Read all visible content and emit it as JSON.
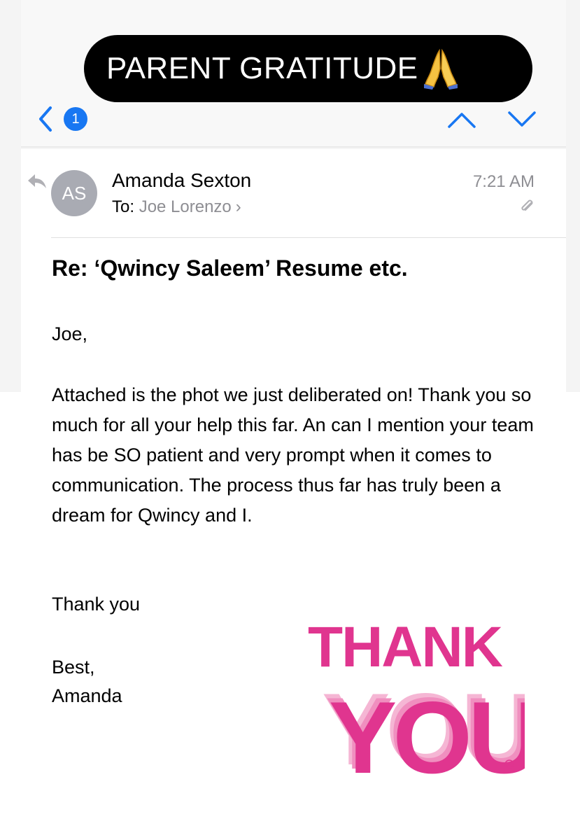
{
  "caption": {
    "text": "PARENT GRATITUDE",
    "emoji": "folded-hands-emoji"
  },
  "nav": {
    "badge_count": "1",
    "back": "chevron-left-icon",
    "prev": "chevron-up-icon",
    "next": "chevron-down-icon"
  },
  "email": {
    "avatar_initials": "AS",
    "sender": "Amanda Sexton",
    "to_label": "To:",
    "to_name": "Joe Lorenzo",
    "time": "7:21 AM",
    "subject": "Re: ‘Qwincy Saleem’ Resume etc.",
    "greeting": "Joe,",
    "paragraph": "Attached is the phot we just deliberated on! Thank you so much for all your help this far. An can I mention your team has be SO patient and very prompt when it comes to communication. The process thus far has truly been a dream for Qwincy and I.",
    "thanks": "Thank you",
    "closing": "Best,",
    "signature": "Amanda"
  },
  "graphic": {
    "line1": "THANK",
    "line2": "YOU",
    "color": "#e0358f",
    "shadow_colors": [
      "#f08fbf",
      "#f5b6d4"
    ]
  },
  "colors": {
    "accent": "#1877f2",
    "secondary_text": "#8e8e93",
    "avatar": "#a9abb3"
  }
}
